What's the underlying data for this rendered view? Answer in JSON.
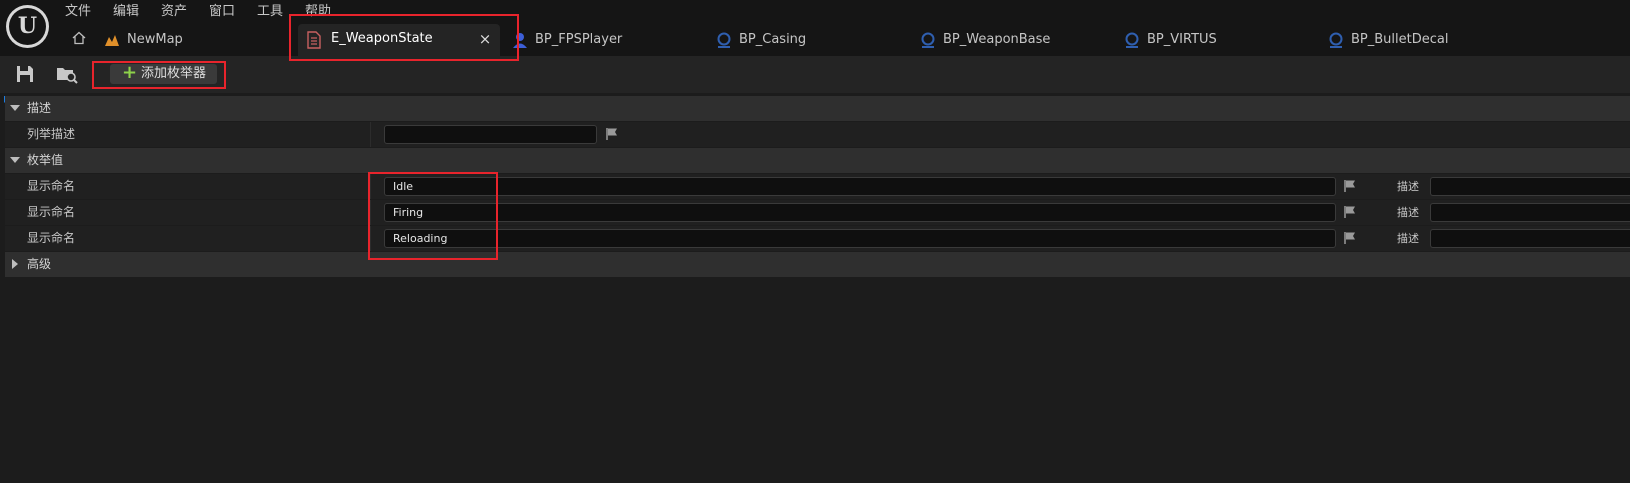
{
  "menu": {
    "items": [
      "文件",
      "编辑",
      "资产",
      "窗口",
      "工具",
      "帮助"
    ]
  },
  "tabs": {
    "map": "NewMap",
    "active": "E_WeaponState",
    "close": "×",
    "others": [
      "BP_FPSPlayer",
      "BP_Casing",
      "BP_WeaponBase",
      "BP_VIRTUS",
      "BP_BulletDecal"
    ]
  },
  "toolbar": {
    "add_enumerator_label": "添加枚举器",
    "add_icon": "plus-icon"
  },
  "details": {
    "description_category": "描述",
    "enum_description_label": "列举描述",
    "enum_description_value": "",
    "enumerators_category": "枚举值",
    "enumerators": [
      {
        "label": "显示命名",
        "value": "Idle",
        "desc_label": "描述",
        "desc_value": ""
      },
      {
        "label": "显示命名",
        "value": "Firing",
        "desc_label": "描述",
        "desc_value": ""
      },
      {
        "label": "显示命名",
        "value": "Reloading",
        "desc_label": "描述",
        "desc_value": ""
      }
    ],
    "advanced_category": "高级"
  },
  "colors": {
    "accent_green": "#8ed24a",
    "highlight_red": "#e8242c",
    "blueprint_blue": "#2f5fb0",
    "character_blue": "#3d5fd8",
    "map_orange": "#e0902a",
    "enum_red": "#c04040"
  }
}
